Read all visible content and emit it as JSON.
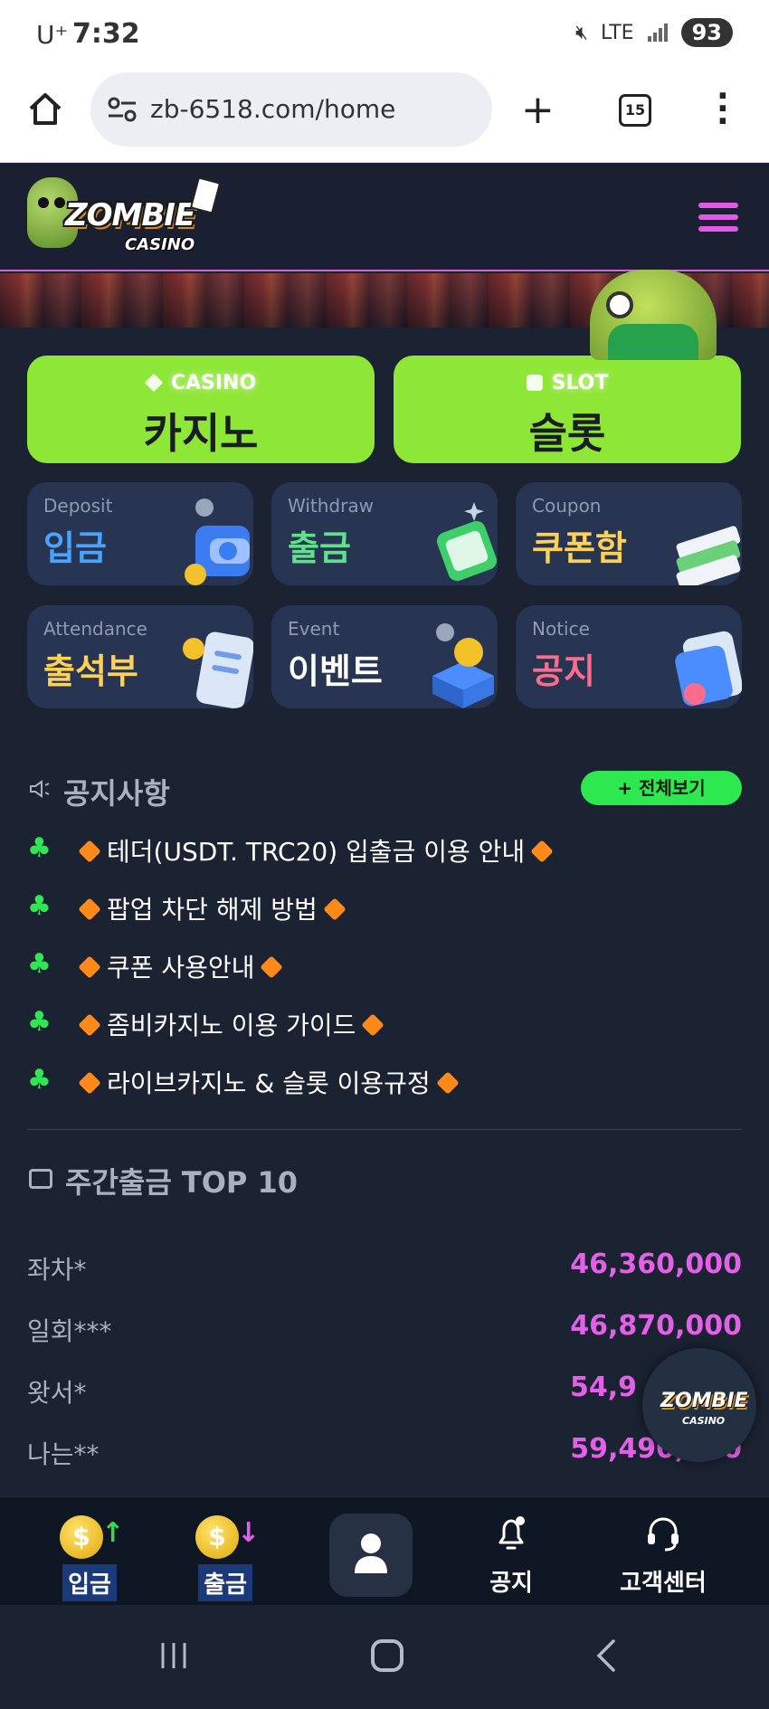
{
  "status_bar": {
    "carrier": "U⁺",
    "time": "7:32",
    "network": "LTE",
    "battery": "93"
  },
  "browser": {
    "url": "zb-6518.com/home",
    "tab_count": "15"
  },
  "header": {
    "logo_text": "ZOMBIE",
    "logo_subtext": "CASINO"
  },
  "main_buttons": [
    {
      "en": "CASINO",
      "ko": "카지노"
    },
    {
      "en": "SLOT",
      "ko": "슬롯"
    }
  ],
  "tiles": [
    {
      "en": "Deposit",
      "ko": "입금"
    },
    {
      "en": "Withdraw",
      "ko": "출금"
    },
    {
      "en": "Coupon",
      "ko": "쿠폰함"
    },
    {
      "en": "Attendance",
      "ko": "출석부"
    },
    {
      "en": "Event",
      "ko": "이벤트"
    },
    {
      "en": "Notice",
      "ko": "공지"
    }
  ],
  "notice": {
    "title": "공지사항",
    "view_all": "+ 전체보기",
    "items": [
      "테더(USDT. TRC20) 입출금 이용 안내",
      "팝업 차단 해제 방법",
      "쿠폰 사용안내",
      "좀비카지노 이용 가이드",
      "라이브카지노 & 슬롯 이용규정"
    ]
  },
  "weekly_top": {
    "title": "주간출금 TOP 10",
    "rows": [
      {
        "name": "좌차*",
        "amount": "46,360,000"
      },
      {
        "name": "일회***",
        "amount": "46,870,000"
      },
      {
        "name": "왓서*",
        "amount": "54,9"
      },
      {
        "name": "나는**",
        "amount": "59,490,000"
      }
    ]
  },
  "floating_badge": {
    "text": "ZOMBIE",
    "subtext": "CASINO"
  },
  "bottom_nav": {
    "deposit": "입금",
    "withdraw": "출금",
    "notice": "공지",
    "support": "고객센터"
  },
  "colors": {
    "accent_green": "#8ee636",
    "accent_pink": "#e460e8",
    "badge_green": "#2ee84f",
    "background": "#1b2232"
  }
}
